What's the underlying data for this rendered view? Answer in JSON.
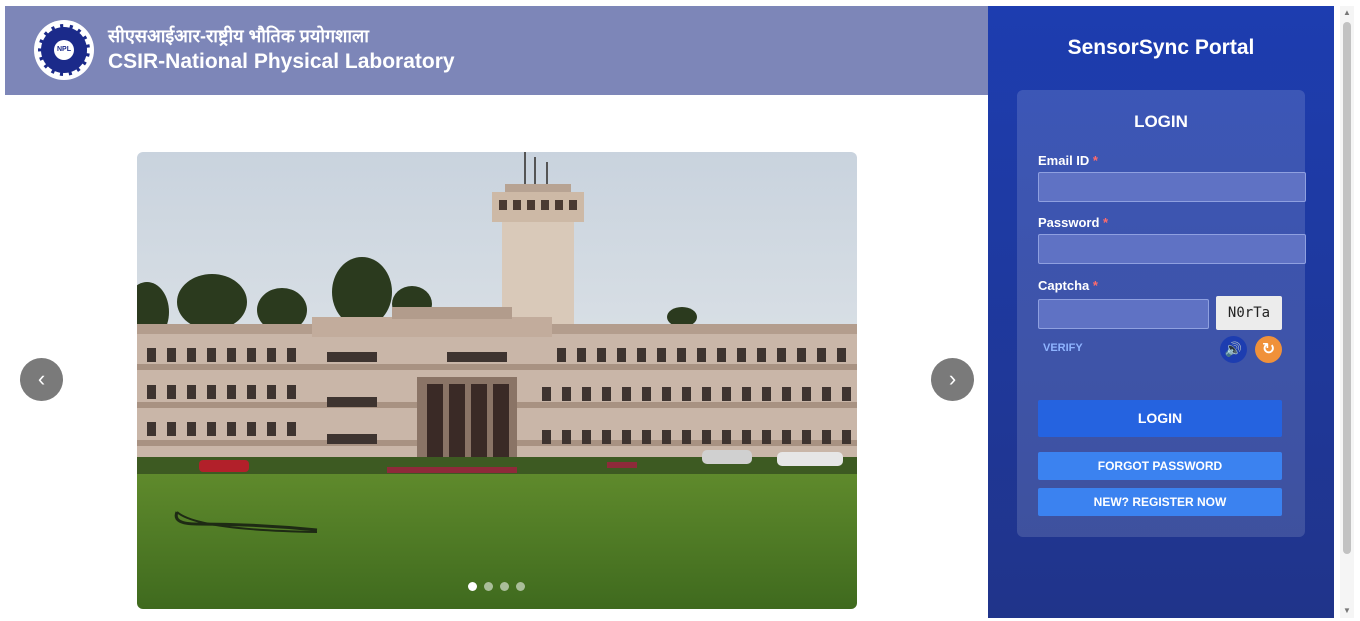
{
  "header": {
    "hindi_title": "सीएसआईआर-राष्ट्रीय भौतिक प्रयोगशाला",
    "english_title": "CSIR-National Physical Laboratory",
    "logo_text": "NPL",
    "background_color": "#7d86b8"
  },
  "carousel": {
    "prev_icon": "‹",
    "next_icon": "›",
    "slide_count": 4,
    "active_slide": 1
  },
  "portal": {
    "title": "SensorSync Portal",
    "panel_color": "#1d3db0"
  },
  "login_form": {
    "title": "LOGIN",
    "email_label": "Email ID",
    "password_label": "Password",
    "captcha_label": "Captcha",
    "required_marker": "*",
    "email_value": "",
    "password_value": "",
    "captcha_value": "",
    "captcha_text": "N0rTa",
    "verify_label": "VERIFY",
    "audio_icon": "🔊",
    "refresh_icon": "↻",
    "login_button": "LOGIN",
    "forgot_button": "FORGOT PASSWORD",
    "register_button": "NEW? REGISTER NOW"
  },
  "scrollbar": {
    "up_icon": "▲",
    "down_icon": "▼"
  }
}
